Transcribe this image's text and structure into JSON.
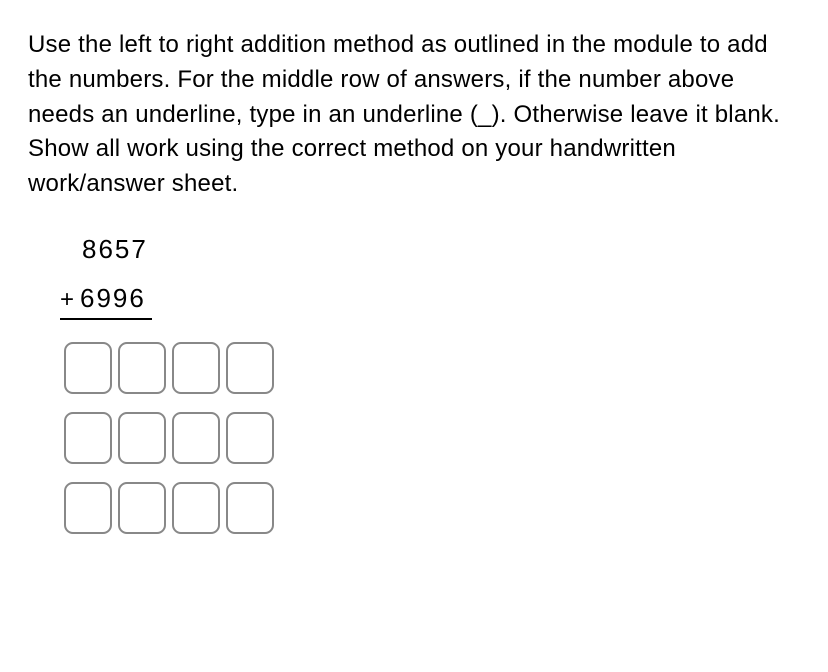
{
  "instructions": "Use the left to right addition method as outlined in the module to add the numbers. For the middle row of answers, if the number above needs an underline, type in an underline (_). Otherwise leave it blank.  Show all work using the correct method on your handwritten work/answer sheet.",
  "problem": {
    "addend1": "8657",
    "operator": "+",
    "addend2": "6996"
  },
  "answers": {
    "row1": [
      "",
      "",
      "",
      ""
    ],
    "row2": [
      "",
      "",
      "",
      ""
    ],
    "row3": [
      "",
      "",
      "",
      ""
    ]
  }
}
